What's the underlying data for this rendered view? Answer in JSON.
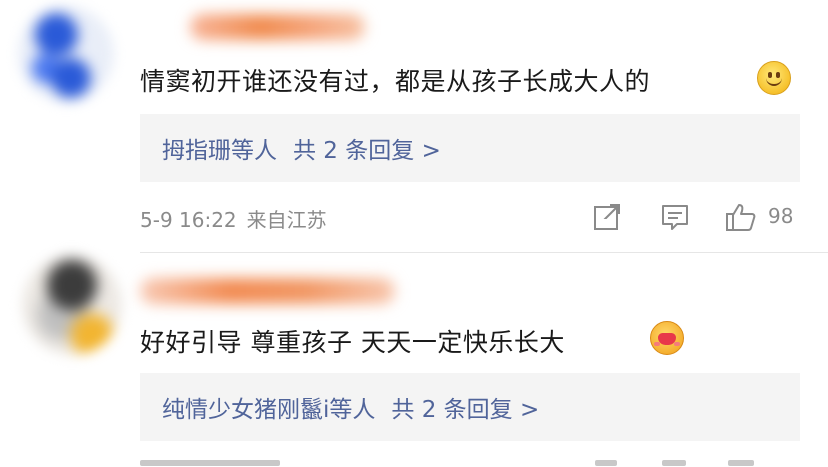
{
  "comments": [
    {
      "text": "情窦初开谁还没有过，都是从孩子长成大人的",
      "emoji": "smile-emoji",
      "reply_users": "拇指珊等人",
      "reply_count": "共 2 条回复 >",
      "time": "5-9 16:22",
      "location": "来自江苏",
      "likes": "98",
      "icons": [
        "share-icon",
        "comment-icon",
        "like-icon"
      ]
    },
    {
      "text": "好好引导 尊重孩子 天天一定快乐长大",
      "emoji": "hug-emoji",
      "reply_users": "纯情少女猪刚鬣i等人",
      "reply_count": "共 2 条回复 >"
    }
  ],
  "colors": {
    "link": "#50649a",
    "meta": "#8a8a8a",
    "reply_bg": "#f4f4f4",
    "text": "#1a1a1a"
  }
}
